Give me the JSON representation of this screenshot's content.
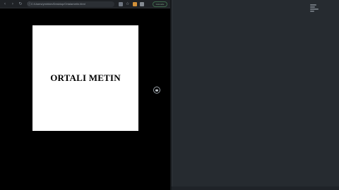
{
  "browser": {
    "address_url": "C:/Users/ymirkim/Desktop/Ortalametin.html",
    "update_label": "Güncelle",
    "nav": {
      "back": "‹",
      "forward": "›",
      "reload": "↻"
    }
  },
  "page": {
    "content_text": "ORTALI METIN",
    "background_color": "#ffffff",
    "text_color": "#000000"
  },
  "icons": {
    "address": "info-icon",
    "floating_control": "scroll-control-icon"
  },
  "editor": {
    "background_color": "#262b30"
  }
}
